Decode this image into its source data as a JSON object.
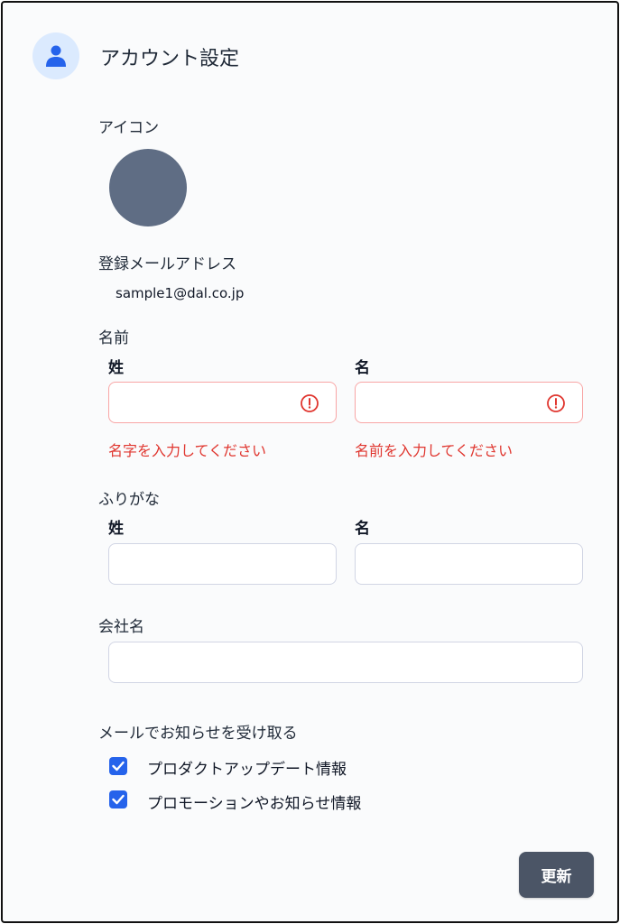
{
  "header": {
    "title": "アカウント設定",
    "avatar_icon": "user-icon"
  },
  "icon_section": {
    "label": "アイコン"
  },
  "email_section": {
    "label": "登録メールアドレス",
    "value": "sample1@dal.co.jp"
  },
  "name_section": {
    "label": "名前",
    "last": {
      "label": "姓",
      "value": "",
      "error": "名字を入力してください"
    },
    "first": {
      "label": "名",
      "value": "",
      "error": "名前を入力してください"
    }
  },
  "kana_section": {
    "label": "ふりがな",
    "last": {
      "label": "姓",
      "value": ""
    },
    "first": {
      "label": "名",
      "value": ""
    }
  },
  "company_section": {
    "label": "会社名",
    "value": ""
  },
  "email_pref": {
    "label": "メールでお知らせを受け取る",
    "options": [
      {
        "label": "プロダクトアップデート情報",
        "checked": true
      },
      {
        "label": "プロモーションやお知らせ情報",
        "checked": true
      }
    ]
  },
  "actions": {
    "update_label": "更新"
  },
  "colors": {
    "error": "#e0362f",
    "accent": "#2563eb",
    "button": "#4b5566"
  }
}
